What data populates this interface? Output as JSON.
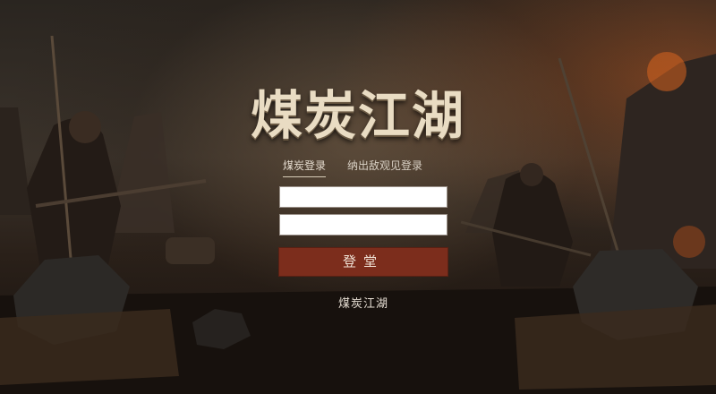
{
  "app": {
    "title": "煤炭江湖"
  },
  "tabs": [
    {
      "label": "煤炭登录"
    },
    {
      "label": "纳出敌观见登录"
    }
  ],
  "form": {
    "username": {
      "value": "",
      "placeholder": ""
    },
    "password": {
      "value": "",
      "placeholder": ""
    },
    "login_label": "登堂"
  },
  "footer": {
    "text": "煤炭江湖"
  },
  "colors": {
    "accent": "#7c2d1c",
    "title": "#e9dcc3",
    "background": "#1a1410"
  }
}
